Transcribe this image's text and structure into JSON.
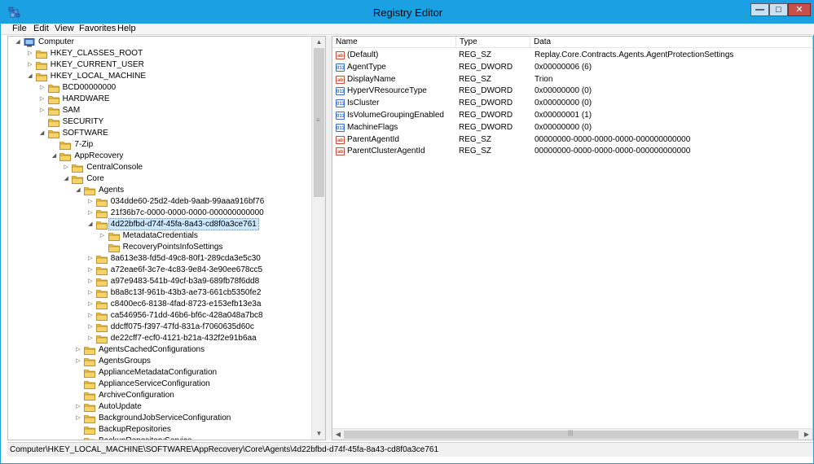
{
  "window": {
    "title": "Registry Editor"
  },
  "caption_buttons": {
    "minimize": "—",
    "maximize": "□",
    "close": "✕"
  },
  "colors": {
    "titlebar": "#1ba1e2",
    "folder": "#e8c04a",
    "selection": "#cce8ff",
    "close": "#c7504c"
  },
  "menu": [
    "File",
    "Edit",
    "View",
    "Favorites",
    "Help"
  ],
  "tree": [
    {
      "label": "Computer",
      "exp": "◢",
      "kind": "computer"
    },
    {
      "label": "HKEY_CLASSES_ROOT",
      "exp": "▷",
      "kind": "folder"
    },
    {
      "label": "HKEY_CURRENT_USER",
      "exp": "▷",
      "kind": "folder"
    },
    {
      "label": "HKEY_LOCAL_MACHINE",
      "exp": "◢",
      "kind": "folder"
    },
    {
      "label": "BCD00000000",
      "exp": "▷",
      "kind": "folder"
    },
    {
      "label": "HARDWARE",
      "exp": "▷",
      "kind": "folder"
    },
    {
      "label": "SAM",
      "exp": "▷",
      "kind": "folder"
    },
    {
      "label": "SECURITY",
      "exp": "",
      "kind": "folder"
    },
    {
      "label": "SOFTWARE",
      "exp": "◢",
      "kind": "folder"
    },
    {
      "label": "7-Zip",
      "exp": "",
      "kind": "folder"
    },
    {
      "label": "AppRecovery",
      "exp": "◢",
      "kind": "folder"
    },
    {
      "label": "CentralConsole",
      "exp": "▷",
      "kind": "folder"
    },
    {
      "label": "Core",
      "exp": "◢",
      "kind": "folder"
    },
    {
      "label": "Agents",
      "exp": "◢",
      "kind": "folder"
    },
    {
      "label": "034dde60-25d2-4deb-9aab-99aaa916bf76",
      "exp": "▷",
      "kind": "folder"
    },
    {
      "label": "21f36b7c-0000-0000-0000-000000000000",
      "exp": "▷",
      "kind": "folder"
    },
    {
      "label": "4d22bfbd-d74f-45fa-8a43-cd8f0a3ce761",
      "exp": "◢",
      "kind": "folder",
      "selected": true
    },
    {
      "label": "MetadataCredentials",
      "exp": "▷",
      "kind": "folder"
    },
    {
      "label": "RecoveryPointsInfoSettings",
      "exp": "",
      "kind": "folder"
    },
    {
      "label": "8a613e38-fd5d-49c8-80f1-289cda3e5c30",
      "exp": "▷",
      "kind": "folder"
    },
    {
      "label": "a72eae6f-3c7e-4c83-9e84-3e90ee678cc5",
      "exp": "▷",
      "kind": "folder"
    },
    {
      "label": "a97e9483-541b-49cf-b3a9-689fb78f6dd8",
      "exp": "▷",
      "kind": "folder"
    },
    {
      "label": "b8a8c13f-961b-43b3-ae73-661cb5350fe2",
      "exp": "▷",
      "kind": "folder"
    },
    {
      "label": "c8400ec6-8138-4fad-8723-e153efb13e3a",
      "exp": "▷",
      "kind": "folder"
    },
    {
      "label": "ca546956-71dd-46b6-bf6c-428a048a7bc8",
      "exp": "▷",
      "kind": "folder"
    },
    {
      "label": "ddcff075-f397-47fd-831a-f7060635d60c",
      "exp": "▷",
      "kind": "folder"
    },
    {
      "label": "de22cff7-ecf0-4121-b21a-432f2e91b6aa",
      "exp": "▷",
      "kind": "folder"
    },
    {
      "label": "AgentsCachedConfigurations",
      "exp": "▷",
      "kind": "folder"
    },
    {
      "label": "AgentsGroups",
      "exp": "▷",
      "kind": "folder"
    },
    {
      "label": "ApplianceMetadataConfiguration",
      "exp": "",
      "kind": "folder"
    },
    {
      "label": "ApplianceServiceConfiguration",
      "exp": "",
      "kind": "folder"
    },
    {
      "label": "ArchiveConfiguration",
      "exp": "",
      "kind": "folder"
    },
    {
      "label": "AutoUpdate",
      "exp": "▷",
      "kind": "folder"
    },
    {
      "label": "BackgroundJobServiceConfiguration",
      "exp": "▷",
      "kind": "folder"
    },
    {
      "label": "BackupRepositories",
      "exp": "",
      "kind": "folder"
    },
    {
      "label": "BackupRepositoryService",
      "exp": "",
      "kind": "folder"
    }
  ],
  "columns": {
    "name": "Name",
    "type": "Type",
    "data": "Data"
  },
  "values": [
    {
      "name": "(Default)",
      "type": "REG_SZ",
      "data": "Replay.Core.Contracts.Agents.AgentProtectionSettings",
      "icon": "string-value-icon",
      "glyph": "ab"
    },
    {
      "name": "AgentType",
      "type": "REG_DWORD",
      "data": "0x00000006 (6)",
      "icon": "binary-value-icon",
      "glyph": "011"
    },
    {
      "name": "DisplayName",
      "type": "REG_SZ",
      "data": "Trion",
      "icon": "string-value-icon",
      "glyph": "ab"
    },
    {
      "name": "HyperVResourceType",
      "type": "REG_DWORD",
      "data": "0x00000000 (0)",
      "icon": "binary-value-icon",
      "glyph": "011"
    },
    {
      "name": "IsCluster",
      "type": "REG_DWORD",
      "data": "0x00000000 (0)",
      "icon": "binary-value-icon",
      "glyph": "011"
    },
    {
      "name": "IsVolumeGroupingEnabled",
      "type": "REG_DWORD",
      "data": "0x00000001 (1)",
      "icon": "binary-value-icon",
      "glyph": "011"
    },
    {
      "name": "MachineFlags",
      "type": "REG_DWORD",
      "data": "0x00000000 (0)",
      "icon": "binary-value-icon",
      "glyph": "011"
    },
    {
      "name": "ParentAgentId",
      "type": "REG_SZ",
      "data": "00000000-0000-0000-0000-000000000000",
      "icon": "string-value-icon",
      "glyph": "ab"
    },
    {
      "name": "ParentClusterAgentId",
      "type": "REG_SZ",
      "data": "00000000-0000-0000-0000-000000000000",
      "icon": "string-value-icon",
      "glyph": "ab"
    }
  ],
  "status": {
    "path": "Computer\\HKEY_LOCAL_MACHINE\\SOFTWARE\\AppRecovery\\Core\\Agents\\4d22bfbd-d74f-45fa-8a43-cd8f0a3ce761"
  }
}
